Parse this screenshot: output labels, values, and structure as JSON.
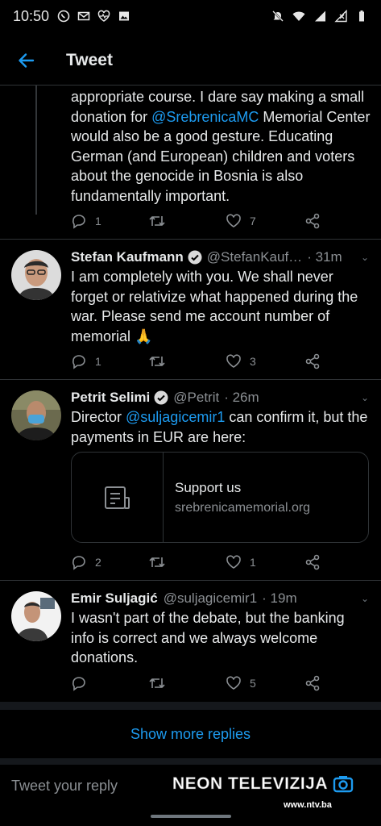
{
  "status_bar": {
    "time": "10:50",
    "left_icons": [
      "whatsapp-icon",
      "mail-icon",
      "health-icon",
      "image-icon"
    ],
    "right_icons": [
      "mute-icon",
      "wifi-icon",
      "signal-icon",
      "no-signal-icon",
      "battery-icon"
    ]
  },
  "header": {
    "title": "Tweet"
  },
  "first_tweet": {
    "text_parts": [
      "appropriate course. I dare say making a small donation for ",
      "@SrebrenicaMC",
      " Memorial Center would also be a good gesture. Educating German (and European) children and voters about the genocide in Bosnia is also fundamentally important."
    ],
    "replies": "1",
    "retweets": "",
    "likes": "7"
  },
  "tweets": [
    {
      "name": "Stefan Kaufmann",
      "handle": "@StefanKauf…",
      "time": "· 31m",
      "text": "I am completely with you. We shall never forget or relativize what happened during the war. Please send me account number of memorial 🙏",
      "replies": "1",
      "retweets": "",
      "likes": "3"
    },
    {
      "name": "Petrit Selimi",
      "handle": "@Petrit",
      "time": "· 26m",
      "text_parts": [
        "Director ",
        "@suljagicemir1",
        " can confirm it, but the payments in EUR are here:"
      ],
      "card": {
        "title": "Support us",
        "url": "srebrenicamemorial.org"
      },
      "replies": "2",
      "retweets": "",
      "likes": "1"
    },
    {
      "name": "Emir Suljagić",
      "handle": "@suljagicemir1",
      "time": "· 19m",
      "text": "I wasn't part of the debate, but the banking info is correct and we always welcome donations.",
      "replies": "",
      "retweets": "",
      "likes": "5"
    }
  ],
  "show_more": "Show more replies",
  "reply": {
    "placeholder": "Tweet your reply"
  },
  "watermark": {
    "brand": "NEON TELEVIZIJA",
    "url": "www.ntv.ba"
  },
  "colors": {
    "accent": "#1d9bf0",
    "background": "#000000",
    "muted": "#8b8f93"
  }
}
